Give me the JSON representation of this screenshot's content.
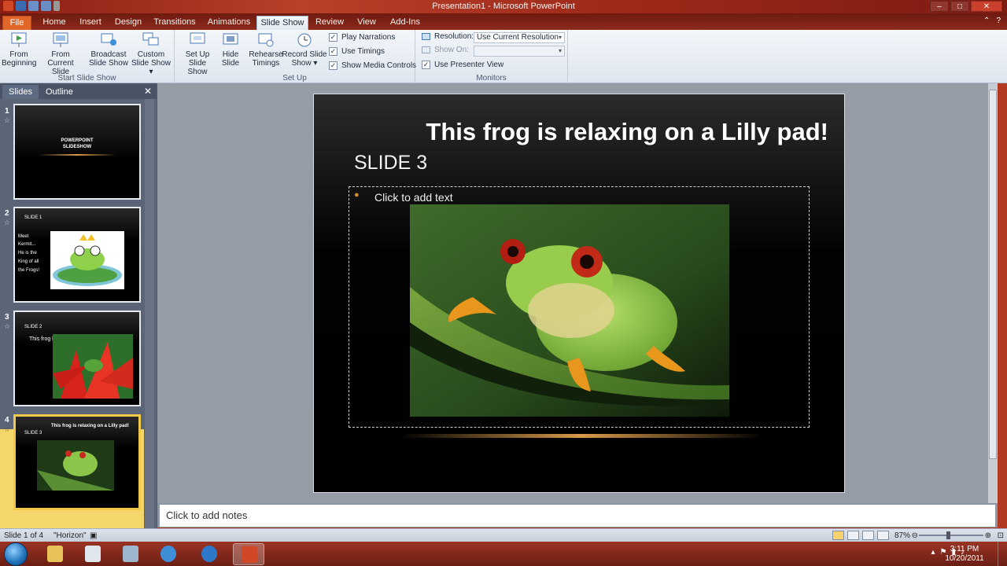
{
  "window": {
    "title": "Presentation1  -  Microsoft PowerPoint"
  },
  "tabs": [
    {
      "label": "File"
    },
    {
      "label": "Home"
    },
    {
      "label": "Insert"
    },
    {
      "label": "Design"
    },
    {
      "label": "Transitions"
    },
    {
      "label": "Animations"
    },
    {
      "label": "Slide Show"
    },
    {
      "label": "Review"
    },
    {
      "label": "View"
    },
    {
      "label": "Add-Ins"
    }
  ],
  "ribbon": {
    "group_start": "Start Slide Show",
    "from_beginning": [
      "From",
      "Beginning"
    ],
    "from_current": [
      "From",
      "Current Slide"
    ],
    "broadcast": [
      "Broadcast",
      "Slide Show"
    ],
    "custom": [
      "Custom",
      "Slide Show"
    ],
    "group_setup": "Set Up",
    "setup": [
      "Set Up",
      "Slide Show"
    ],
    "hide": [
      "Hide",
      "Slide"
    ],
    "rehearse": [
      "Rehearse",
      "Timings"
    ],
    "record": [
      "Record Slide",
      "Show"
    ],
    "play_narrations": "Play Narrations",
    "use_timings": "Use Timings",
    "show_media": "Show Media Controls",
    "group_monitors": "Monitors",
    "resolution_label": "Resolution:",
    "resolution_value": "Use Current Resolution",
    "show_on_label": "Show On:",
    "presenter_view": "Use Presenter View"
  },
  "left_pane": {
    "tab_slides": "Slides",
    "tab_outline": "Outline",
    "thumbs": [
      {
        "num": "1",
        "line1": "POWERPOINT",
        "line2": "SLIDESHOW"
      },
      {
        "num": "2",
        "title": "SLIDE 1",
        "lines": [
          "Meet",
          "Kermit...",
          "He is the",
          "King of all",
          "the Frogs!"
        ]
      },
      {
        "num": "3",
        "title": "SLIDE 2",
        "text": "This frog has huge red eyeballs!"
      },
      {
        "num": "4",
        "title": "SLIDE 3",
        "heading": "This frog is relaxing on a Lilly pad!"
      }
    ]
  },
  "slide": {
    "title": "This frog is relaxing on a Lilly pad!",
    "subtitle": "SLIDE 3",
    "placeholder": "Click to add text"
  },
  "notes": {
    "placeholder": "Click to add notes"
  },
  "status": {
    "slide_count": "Slide 1 of 4",
    "theme": "\"Horizon\"",
    "zoom": "87%",
    "zoom_fraction": 0.45
  },
  "taskbar": {
    "time": "3:11 PM",
    "date": "10/20/2011"
  },
  "colors": {
    "accent": "#e0662a",
    "selected_slide": "#f2c84b",
    "title_bar": "#a02a1a"
  }
}
